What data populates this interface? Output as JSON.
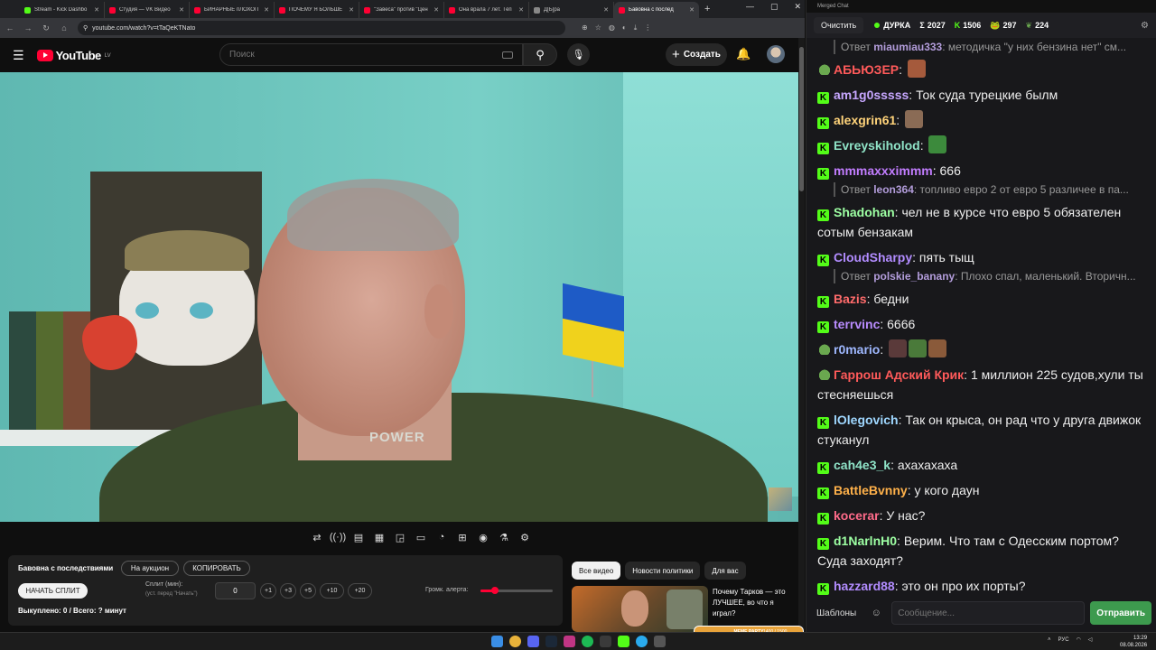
{
  "browser": {
    "tabs": [
      {
        "label": "Stream - Kick Dashbo",
        "icon": "kick"
      },
      {
        "label": "Студия — VK Видео",
        "icon": "yt"
      },
      {
        "label": "БИНАРНЫЕ пЛОХОП",
        "icon": "yt"
      },
      {
        "label": "ПОЧЕМУ Я БОЛЬШЕ",
        "icon": "yt"
      },
      {
        "label": "\"Завеса\" против \"Цен",
        "icon": "yt"
      },
      {
        "label": "Она врала 7 лет. Тёп",
        "icon": "yt"
      },
      {
        "label": "Д[Ь]ра",
        "icon": "gen"
      },
      {
        "label": "Бавовна с послед",
        "icon": "yt",
        "active": true
      }
    ],
    "new_tab": "+",
    "url": "youtube.com/watch?v=tTaQeKTNato",
    "window_controls": [
      "—",
      "▢",
      "✕"
    ]
  },
  "youtube": {
    "logo_text": "YouTube",
    "region": "LV",
    "search_placeholder": "Поиск",
    "create_label": "Создать"
  },
  "video_overlay": {
    "shirt_text": "POWER"
  },
  "controls": {
    "icons": [
      "repeat-icon",
      "broadcast-icon",
      "subtitles-icon",
      "clapper-icon",
      "pip-icon",
      "theater-icon",
      "speed-icon",
      "add-icon",
      "camera-icon",
      "flask-icon",
      "gear-icon"
    ],
    "glyphs": [
      "⇄",
      "((·))",
      "▤",
      "▦",
      "◲",
      "▭",
      "◔",
      "⊞",
      "◉",
      "⚗",
      "⚙"
    ]
  },
  "panel": {
    "title": "Бавовна с последствиями",
    "auction_label": "На аукцион",
    "copy_label": "КОПИРОВАТЬ",
    "start_label": "НАЧАТЬ СПЛИТ",
    "split_label": "Сплит (мин):",
    "split_hint": "(уст. перед \"Начать\")",
    "split_value": "0",
    "increments": [
      "+1",
      "+3",
      "+5",
      "+10",
      "+20"
    ],
    "volume_label": "Громк. алерта:",
    "volume_level": 0.2,
    "status": "Выкуплено: 0 / Всего: ? минут"
  },
  "recommendations": {
    "chips": [
      "Все видео",
      "Новости политики",
      "Для вас"
    ],
    "video_title": "Почему Тарков — это ЛУЧШЕЕ, во что я играл?"
  },
  "chat": {
    "window_title": "Merged Chat",
    "clear_label": "Очистить",
    "channel": "ДУРКА",
    "stats": [
      {
        "icon": "sigma",
        "glyph": "Σ",
        "value": "2027"
      },
      {
        "icon": "kick-icon",
        "glyph": "K",
        "value": "1506"
      },
      {
        "icon": "frog-icon",
        "glyph": "🐸",
        "value": "297"
      },
      {
        "icon": "leaf-icon",
        "glyph": "❦",
        "value": "224"
      }
    ],
    "messages": [
      {
        "reply": true,
        "reply_prefix": "Ответ",
        "reply_user": "miaumiau333",
        "reply_text": ": методичка \"у них бензина нет\" см..."
      },
      {
        "platform": "frog",
        "user": "АБЬЮЗЕР",
        "color": "#ff5a5a",
        "text": "",
        "emotes": [
          "#a55a3c"
        ]
      },
      {
        "platform": "kick",
        "user": "am1g0sssss",
        "color": "#c7a7ff",
        "text": "Ток суда турецкие былм"
      },
      {
        "platform": "kick",
        "user": "alexgrin61",
        "color": "#ffd37a",
        "text": "",
        "emotes": [
          "#8a6b55"
        ]
      },
      {
        "platform": "kick",
        "user": "Evreyskiholod",
        "color": "#8fe3c7",
        "text": "",
        "emotes": [
          "#3c8a3c"
        ]
      },
      {
        "platform": "kick",
        "user": "mmmaxxximmm",
        "color": "#c27dff",
        "text": "666"
      },
      {
        "reply": true,
        "reply_prefix": "Ответ",
        "reply_user": "leon364",
        "reply_text": ": топливо евро 2 от евро 5 различее в па..."
      },
      {
        "platform": "kick",
        "user": "Shadohan",
        "color": "#9dffa3",
        "text": "чел не в курсе что евро 5 обязателен сотым бензакам"
      },
      {
        "platform": "kick",
        "user": "CloudSharpy",
        "color": "#b28cff",
        "text": "пять тыщ"
      },
      {
        "reply": true,
        "reply_prefix": "Ответ",
        "reply_user": "polskie_banany",
        "reply_text": ": Плохо спал, маленький. Вторичн..."
      },
      {
        "platform": "kick",
        "user": "Bazis",
        "color": "#ff6b6b",
        "text": "бедни"
      },
      {
        "platform": "kick",
        "user": "terrvinc",
        "color": "#b98cff",
        "text": "6666"
      },
      {
        "platform": "frog",
        "user": "r0mario",
        "color": "#9fb8ff",
        "text": "",
        "emotes": [
          "#5a3a3a",
          "#4a7a3a",
          "#8a5a3a"
        ]
      },
      {
        "platform": "frog",
        "user": "Гаррош Адский Крик",
        "color": "#ff5a5a",
        "text": "1 миллион 225 судов,хули ты стесняешься"
      },
      {
        "platform": "kick",
        "user": "lOlegovich",
        "color": "#9fd7ff",
        "text": "Так он крыса, он рад что у друга движок стуканул"
      },
      {
        "platform": "kick",
        "user": "cah4e3_k",
        "color": "#8fe3c7",
        "text": "ахахахаха"
      },
      {
        "platform": "kick",
        "user": "BattleBvnny",
        "color": "#ffb14a",
        "text": "у кого даун"
      },
      {
        "platform": "kick",
        "user": "kocerar",
        "color": "#ff6b8a",
        "text": "У нас?"
      },
      {
        "platform": "kick",
        "user": "d1NarlnH0",
        "color": "#9dffa3",
        "text": "Верим. Что там с Одесским портом? Суда заходят?"
      },
      {
        "platform": "kick",
        "user": "hazzard88",
        "color": "#b28cff",
        "text": "это он про их порты?"
      }
    ],
    "templates_label": "Шаблоны",
    "input_placeholder": "Сообщение...",
    "send_label": "Отправить"
  },
  "taskbar": {
    "lang": "РУС",
    "time": "13:29",
    "date": "08.08.2026",
    "meme_label": "MEME PARTY",
    "meme_value": "1400 / 1500"
  },
  "colors": {
    "kick": "#53fc18",
    "youtube_red": "#ff0033",
    "send": "#3d9a4e"
  }
}
